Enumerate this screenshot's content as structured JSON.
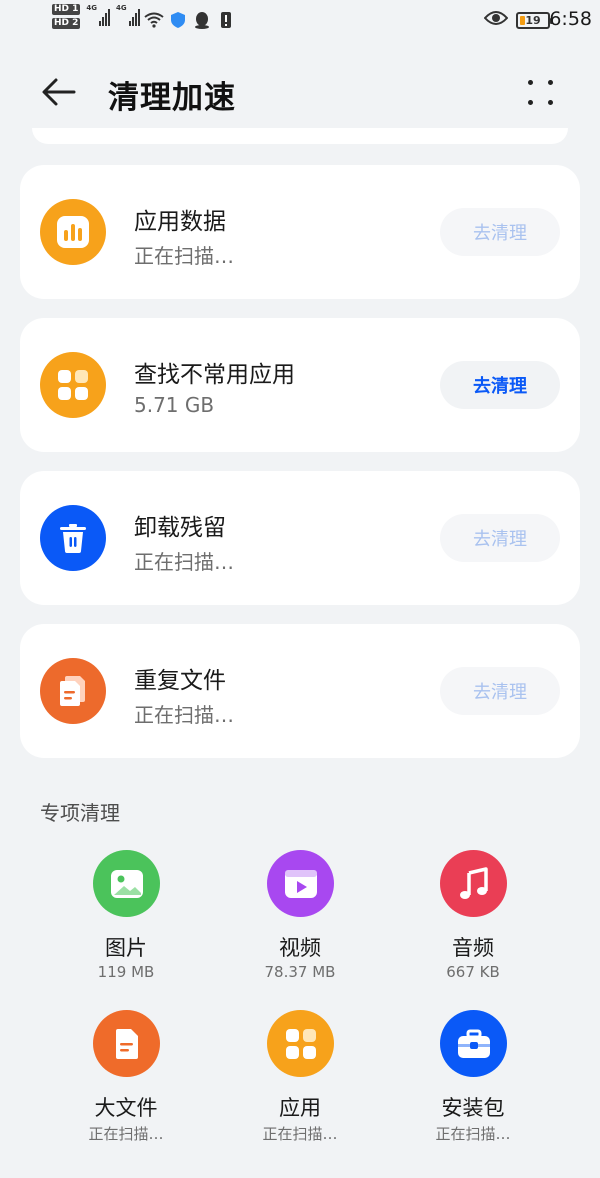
{
  "status_bar": {
    "hd1": "HD 1",
    "hd2": "HD 2",
    "net1": "4G",
    "net2": "4G",
    "battery_level": "19",
    "time": "6:58"
  },
  "header": {
    "title": "清理加速"
  },
  "cards": [
    {
      "title": "应用数据",
      "subtitle": "正在扫描…",
      "button": "去清理",
      "enabled": false,
      "icon": "bar-chart-icon",
      "color": "#f7a21b"
    },
    {
      "title": "查找不常用应用",
      "subtitle": "5.71 GB",
      "button": "去清理",
      "enabled": true,
      "icon": "apps-grid-icon",
      "color": "#f7a21b"
    },
    {
      "title": "卸载残留",
      "subtitle": "正在扫描…",
      "button": "去清理",
      "enabled": false,
      "icon": "trash-icon",
      "color": "#0a59f7"
    },
    {
      "title": "重复文件",
      "subtitle": "正在扫描…",
      "button": "去清理",
      "enabled": false,
      "icon": "duplicate-file-icon",
      "color": "#ed6a2c"
    }
  ],
  "special": {
    "title": "专项清理",
    "items": [
      {
        "label": "图片",
        "value": "119 MB",
        "icon": "picture-icon",
        "color": "#4bc35b"
      },
      {
        "label": "视频",
        "value": "78.37 MB",
        "icon": "video-icon",
        "color": "#a848f0"
      },
      {
        "label": "音频",
        "value": "667 KB",
        "icon": "music-icon",
        "color": "#ea3e55"
      },
      {
        "label": "大文件",
        "value": "正在扫描…",
        "icon": "document-icon",
        "color": "#ef6b2a"
      },
      {
        "label": "应用",
        "value": "正在扫描…",
        "icon": "apps-grid-icon",
        "color": "#f7a21b"
      },
      {
        "label": "安装包",
        "value": "正在扫描…",
        "icon": "package-icon",
        "color": "#0a59f7"
      }
    ]
  }
}
